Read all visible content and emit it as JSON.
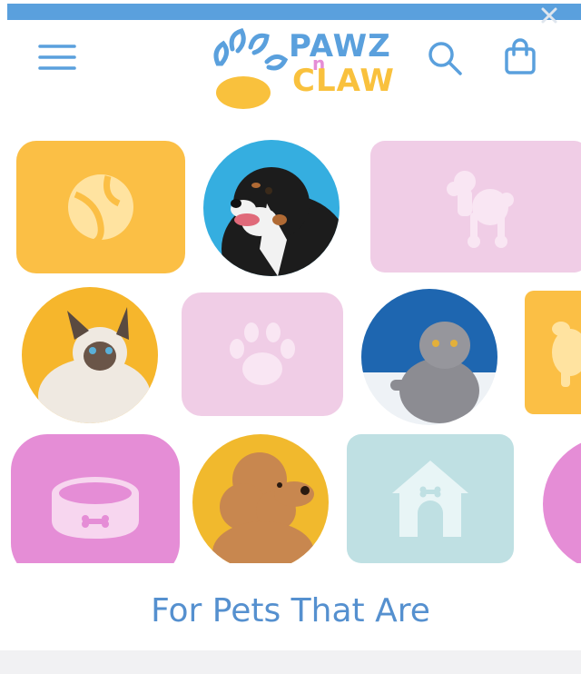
{
  "top_bar": {
    "close_icon": "close-icon",
    "color": "#5aa0dd"
  },
  "header": {
    "menu_icon": "hamburger-menu-icon",
    "logo": {
      "line1": "PAWZ",
      "connector": "n",
      "line2": "CLAW"
    },
    "search_icon": "search-icon",
    "cart_icon": "shopping-bag-icon"
  },
  "hero_grid": {
    "tiles": [
      {
        "name": "tennis-ball-icon",
        "color": "#fbbf45"
      },
      {
        "name": "dog-bernese-photo"
      },
      {
        "name": "poodle-icon",
        "color": "#f0cde6"
      },
      {
        "name": "cat-siamese-photo"
      },
      {
        "name": "paw-print-icon",
        "color": "#f0cde6"
      },
      {
        "name": "cat-grey-photo"
      },
      {
        "name": "dog-silhouette-icon",
        "color": "#fbbf45"
      },
      {
        "name": "pet-bowl-icon",
        "color": "#e58dd6"
      },
      {
        "name": "dog-poodle-photo"
      },
      {
        "name": "dog-house-icon",
        "color": "#bfe0e3"
      }
    ]
  },
  "headline": "For Pets That Are",
  "colors": {
    "primary_blue": "#5aa0dd",
    "yellow": "#fbbf45",
    "pink": "#f0cde6",
    "magenta": "#e58dd6",
    "teal": "#bfe0e3"
  }
}
